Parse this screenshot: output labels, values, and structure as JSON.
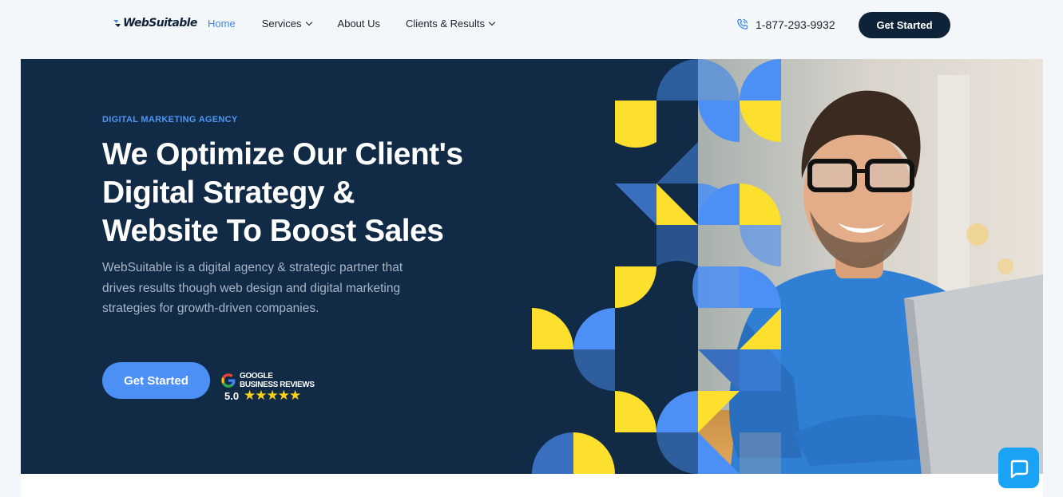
{
  "brand": {
    "name": "WebSuitable"
  },
  "nav": {
    "items": [
      {
        "label": "Home",
        "active": true,
        "has_dropdown": false
      },
      {
        "label": "Services",
        "active": false,
        "has_dropdown": true
      },
      {
        "label": "About Us",
        "active": false,
        "has_dropdown": false
      },
      {
        "label": "Clients & Results",
        "active": false,
        "has_dropdown": true
      }
    ]
  },
  "header": {
    "phone": "1-877-293-9932",
    "cta_label": "Get Started"
  },
  "hero": {
    "eyebrow": "DIGITAL MARKETING AGENCY",
    "title_lines": [
      "We Optimize Our Client's",
      "Digital Strategy &",
      "Website To Boost Sales"
    ],
    "description": "WebSuitable is a digital agency & strategic partner that drives results though web design and digital marketing strategies for growth-driven companies.",
    "cta_label": "Get Started",
    "reviews": {
      "line1": "GOOGLE",
      "line2": "BUSINESS REVIEWS",
      "score": "5.0",
      "stars": "★★★★★"
    }
  },
  "icons": {
    "phone": "phone-icon",
    "google": "google-icon",
    "chat": "chat-icon"
  },
  "colors": {
    "navy": "#112a46",
    "dark": "#0f2338",
    "accent_blue": "#4c8ff5",
    "yellow": "#fde02e",
    "mid_blue": "#3a6fbf",
    "chat": "#1aa2f5"
  }
}
